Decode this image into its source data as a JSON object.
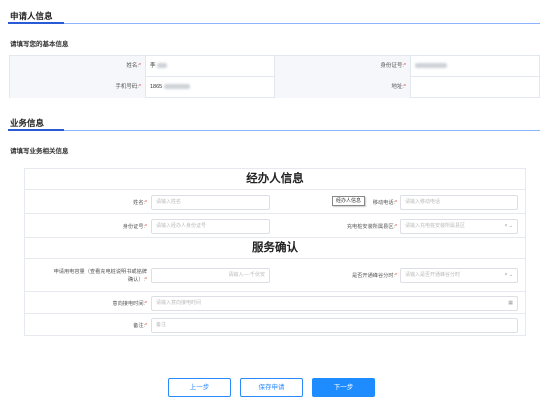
{
  "applicant_section": {
    "title": "申请人信息",
    "subtitle": "请填写您的基本信息",
    "name_label": "姓名:",
    "name_value": "李",
    "id_label": "身份证号:",
    "id_value": "",
    "phone_label": "手机号码:",
    "phone_value": "1865",
    "address_label": "地址:",
    "address_value": ""
  },
  "business_section": {
    "title": "业务信息",
    "subtitle": "请填写业务相关信息"
  },
  "form": {
    "handler_title": "经办人信息",
    "name_label": "姓名:",
    "name_placeholder": "请输入姓名",
    "mobile_label": "移动电话:",
    "mobile_placeholder": "请输入移动电话",
    "tooltip": "经办人信息",
    "id_label": "身份证号:",
    "id_placeholder": "请输入经办人身份证号",
    "district_label": "充电桩安装所属县区:",
    "district_placeholder": "请输入充电桩安装所属县区",
    "service_title": "服务确认",
    "capacity_label_1": "申请用电容量（查看充电桩说明书或铭牌",
    "capacity_label_2": "确认）:",
    "capacity_placeholder": "请输入----千伏安",
    "timeshare_label": "是否开通峰谷分时:",
    "timeshare_placeholder": "请输入是否开通峰谷分时",
    "connect_time_label": "意向接电时间:",
    "connect_time_placeholder": "请输入意向接电时间",
    "remark_label": "备注:",
    "remark_placeholder": "备注",
    "required_mark": "*",
    "clear_icon": "×",
    "chevron_icon": "⌄",
    "calendar_icon": "▦"
  },
  "buttons": {
    "prev": "上一步",
    "save": "保存申请",
    "next": "下一步"
  },
  "colors": {
    "accent": "#1e8cff",
    "required": "#ee3333"
  }
}
